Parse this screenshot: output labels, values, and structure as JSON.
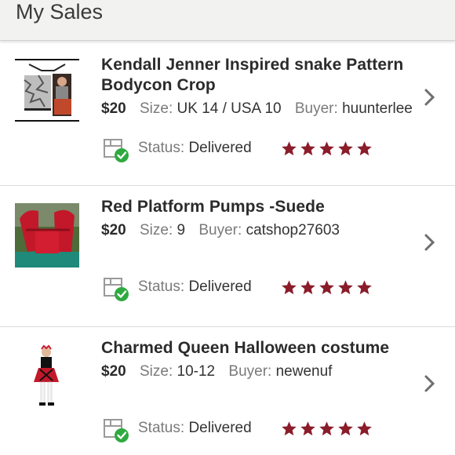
{
  "header": {
    "title": "My Sales"
  },
  "labels": {
    "size": "Size:",
    "buyer": "Buyer:",
    "status": "Status:"
  },
  "sales": [
    {
      "title_line1": "Kendall Jenner Inspired snake Pattern",
      "title_line2": "Bodycon Crop",
      "price": "$20",
      "size": "UK 14 / USA 10",
      "buyer": "huunterlee",
      "status": "Delivered",
      "rating": 5
    },
    {
      "title_line1": "Red Platform Pumps -Suede",
      "title_line2": "",
      "price": "$20",
      "size": "9",
      "buyer": "catshop27603",
      "status": "Delivered",
      "rating": 5
    },
    {
      "title_line1": "Charmed Queen Halloween costume",
      "title_line2": "",
      "price": "$20",
      "size": "10-12",
      "buyer": "newenuf",
      "status": "Delivered",
      "rating": 5
    }
  ],
  "colors": {
    "star": "#8b1c2a",
    "check": "#2eaa3f",
    "chevron": "#6e6e6e",
    "header_bg": "#f2f2f0"
  }
}
